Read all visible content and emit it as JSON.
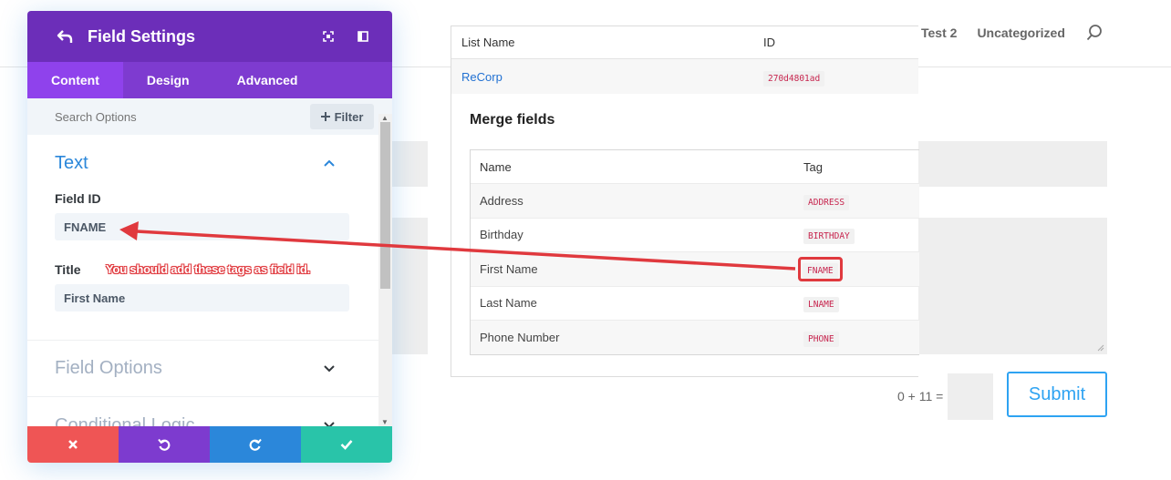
{
  "site": {
    "nav": [
      "Test 2",
      "Uncategorized"
    ],
    "captcha_label": "0 + 11 =",
    "submit_label": "Submit"
  },
  "info_popup": {
    "list_headers": {
      "name": "List Name",
      "id": "ID"
    },
    "list_row": {
      "name": "ReCorp",
      "id": "270d4801ad"
    },
    "merge_title": "Merge fields",
    "merge_headers": {
      "name": "Name",
      "tag": "Tag"
    },
    "merge_rows": [
      {
        "name": "Address",
        "tag": "ADDRESS"
      },
      {
        "name": "Birthday",
        "tag": "BIRTHDAY"
      },
      {
        "name": "First Name",
        "tag": "FNAME"
      },
      {
        "name": "Last Name",
        "tag": "LNAME"
      },
      {
        "name": "Phone Number",
        "tag": "PHONE"
      }
    ]
  },
  "panel": {
    "title": "Field Settings",
    "tabs": [
      "Content",
      "Design",
      "Advanced"
    ],
    "active_tab": "Content",
    "search_placeholder": "Search Options",
    "filter_label": "Filter",
    "sections": {
      "text": {
        "title": "Text",
        "field_id_label": "Field ID",
        "field_id_value": "FNAME",
        "title_label": "Title",
        "title_value": "First Name"
      },
      "field_options": "Field Options",
      "conditional_logic": "Conditional Logic"
    },
    "footer_colors": [
      "#ef5555",
      "#7d3bcf",
      "#2b87da",
      "#29c4a9"
    ]
  },
  "annotation": {
    "text": "You should add these tags as field id.",
    "color": "#e0393e"
  }
}
